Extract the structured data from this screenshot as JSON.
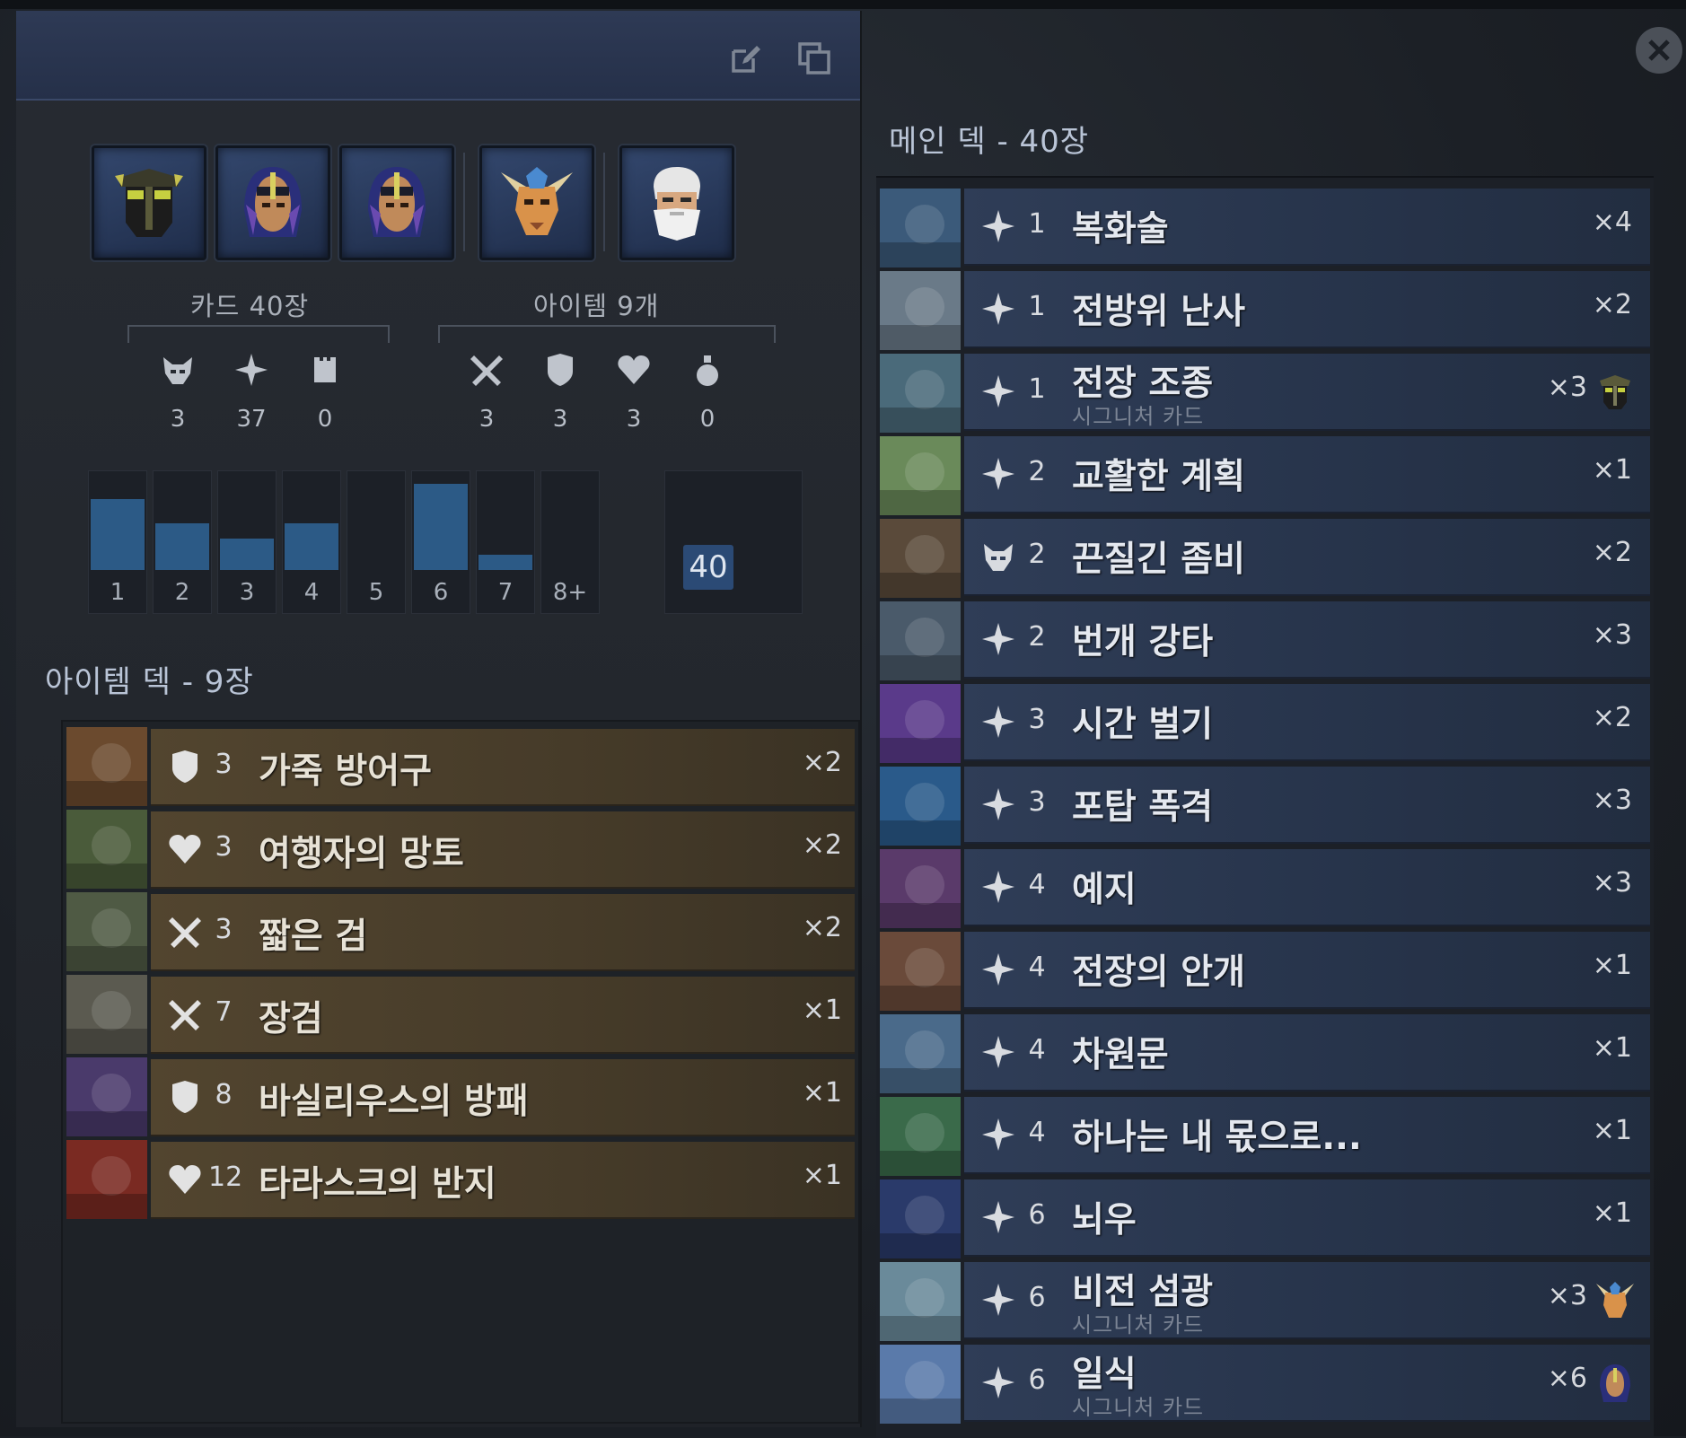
{
  "colors": {
    "item_bar": "#52452f",
    "card_bar": "#2f3d57",
    "histogram_fill": "#2c5a86",
    "header": "#2e3a55"
  },
  "header": {
    "edit_icon": "edit-icon",
    "copy_icon": "copy-icon"
  },
  "heroes": [
    {
      "name": "helmet-hero-portrait"
    },
    {
      "name": "hooded-hero-portrait"
    },
    {
      "name": "hooded-hero-portrait"
    },
    {
      "name": "horned-hero-portrait"
    },
    {
      "name": "bearded-hero-portrait"
    }
  ],
  "stats": {
    "cards_title": "카드 40장",
    "items_title": "아이템 9개",
    "card_types": [
      {
        "icon": "creep-icon",
        "value": "3"
      },
      {
        "icon": "spell-icon",
        "value": "37"
      },
      {
        "icon": "improvement-icon",
        "value": "0"
      }
    ],
    "item_types": [
      {
        "icon": "weapon-icon",
        "value": "3"
      },
      {
        "icon": "armor-icon",
        "value": "3"
      },
      {
        "icon": "health-icon",
        "value": "3"
      },
      {
        "icon": "consumable-icon",
        "value": "0"
      }
    ]
  },
  "mana_curve": {
    "labels": [
      "1",
      "2",
      "3",
      "4",
      "5",
      "6",
      "7",
      "8+"
    ],
    "counts": [
      9,
      6,
      4,
      6,
      0,
      11,
      2,
      0
    ],
    "max": 11,
    "total": "40"
  },
  "item_deck": {
    "title": "아이템 덱 - 9장",
    "items": [
      {
        "icon": "armor-icon",
        "cost": "3",
        "name": "가죽 방어구",
        "count": "×2",
        "thumb": "#6b4a2e"
      },
      {
        "icon": "health-icon",
        "cost": "3",
        "name": "여행자의 망토",
        "count": "×2",
        "thumb": "#4a5b3a"
      },
      {
        "icon": "weapon-icon",
        "cost": "3",
        "name": "짧은 검",
        "count": "×2",
        "thumb": "#4f5a44"
      },
      {
        "icon": "weapon-icon",
        "cost": "7",
        "name": "장검",
        "count": "×1",
        "thumb": "#5b5a50"
      },
      {
        "icon": "armor-icon",
        "cost": "8",
        "name": "바실리우스의 방패",
        "count": "×1",
        "thumb": "#4a3a6b"
      },
      {
        "icon": "health-icon",
        "cost": "12",
        "name": "타라스크의 반지",
        "count": "×1",
        "thumb": "#7a2a22"
      }
    ]
  },
  "main_deck": {
    "title": "메인 덱 - 40장",
    "signature_label": "시그니처 카드",
    "cards": [
      {
        "icon": "spell-icon",
        "cost": "1",
        "name": "복화술",
        "count": "×4",
        "signature": false,
        "thumb": "#3b5a7a"
      },
      {
        "icon": "spell-icon",
        "cost": "1",
        "name": "전방위 난사",
        "count": "×2",
        "signature": false,
        "thumb": "#6a7a88"
      },
      {
        "icon": "spell-icon",
        "cost": "1",
        "name": "전장 조종",
        "count": "×3",
        "signature": true,
        "hero": "helmet-hero-icon",
        "thumb": "#4a6a7a"
      },
      {
        "icon": "spell-icon",
        "cost": "2",
        "name": "교활한 계획",
        "count": "×1",
        "signature": false,
        "thumb": "#6a8a5a"
      },
      {
        "icon": "creep-icon",
        "cost": "2",
        "name": "끈질긴 좀비",
        "count": "×2",
        "signature": false,
        "thumb": "#5a4a3a"
      },
      {
        "icon": "spell-icon",
        "cost": "2",
        "name": "번개 강타",
        "count": "×3",
        "signature": false,
        "thumb": "#4a5a6a"
      },
      {
        "icon": "spell-icon",
        "cost": "3",
        "name": "시간 벌기",
        "count": "×2",
        "signature": false,
        "thumb": "#5a3a8a"
      },
      {
        "icon": "spell-icon",
        "cost": "3",
        "name": "포탑 폭격",
        "count": "×3",
        "signature": false,
        "thumb": "#2a5a8a"
      },
      {
        "icon": "spell-icon",
        "cost": "4",
        "name": "예지",
        "count": "×3",
        "signature": false,
        "thumb": "#5a3a6a"
      },
      {
        "icon": "spell-icon",
        "cost": "4",
        "name": "전장의 안개",
        "count": "×1",
        "signature": false,
        "thumb": "#6a4a3a"
      },
      {
        "icon": "spell-icon",
        "cost": "4",
        "name": "차원문",
        "count": "×1",
        "signature": false,
        "thumb": "#4a6a8a"
      },
      {
        "icon": "spell-icon",
        "cost": "4",
        "name": "하나는 내 몫으로...",
        "count": "×1",
        "signature": false,
        "thumb": "#3a6a4a"
      },
      {
        "icon": "spell-icon",
        "cost": "6",
        "name": "뇌우",
        "count": "×1",
        "signature": false,
        "thumb": "#2a3a6a"
      },
      {
        "icon": "spell-icon",
        "cost": "6",
        "name": "비전 섬광",
        "count": "×3",
        "signature": true,
        "hero": "horned-hero-icon",
        "thumb": "#6a8a9a"
      },
      {
        "icon": "spell-icon",
        "cost": "6",
        "name": "일식",
        "count": "×6",
        "signature": true,
        "hero": "hooded-hero-icon",
        "thumb": "#5a7aaa"
      }
    ]
  }
}
